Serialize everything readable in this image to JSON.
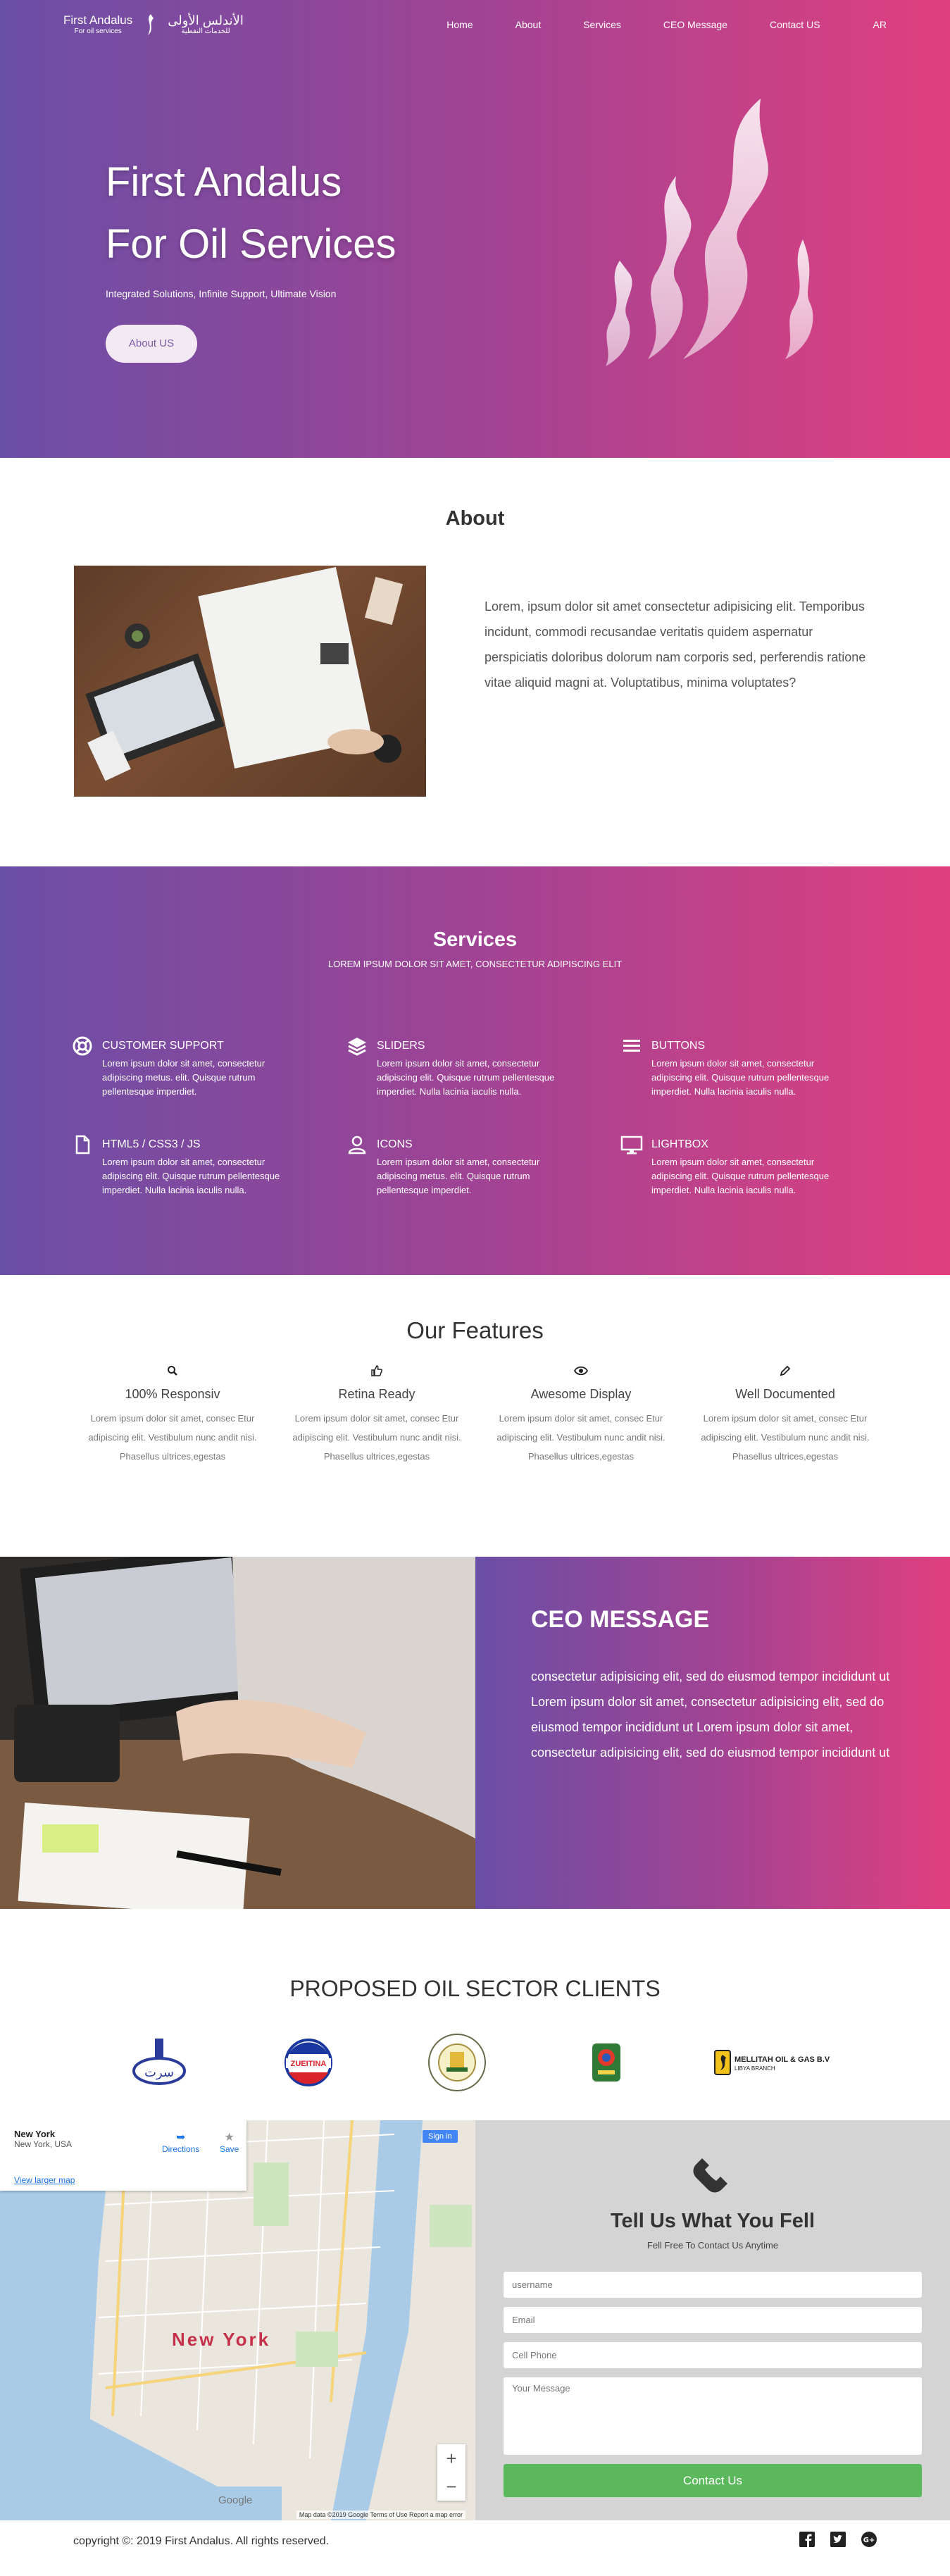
{
  "brand": {
    "name_en": "First Andalus",
    "tagline_en": "For oil services",
    "name_ar": "الأندلس الأولى",
    "tagline_ar": "للخدمات النفطية"
  },
  "nav": {
    "items": [
      "Home",
      "About",
      "Services",
      "CEO Message",
      "Contact US"
    ],
    "lang": "AR"
  },
  "hero": {
    "title_line1": "First Andalus",
    "title_line2": "For Oil Services",
    "subtitle": "Integrated Solutions, Infinite Support, Ultimate Vision",
    "button": "About US"
  },
  "about": {
    "title": "About",
    "text": "Lorem, ipsum dolor sit amet consectetur adipisicing elit. Temporibus incidunt, commodi recusandae veritatis quidem aspernatur perspiciatis doloribus dolorum nam corporis sed, perferendis ratione vitae aliquid magni at. Voluptatibus, minima voluptates?"
  },
  "services": {
    "title": "Services",
    "subtitle": "LOREM IPSUM DOLOR SIT AMET, CONSECTETUR ADIPISCING ELIT",
    "items": [
      {
        "icon": "life-ring-icon",
        "title": "CUSTOMER SUPPORT",
        "text": "Lorem ipsum dolor sit amet, consectetur adipiscing metus. elit. Quisque rutrum pellentesque imperdiet."
      },
      {
        "icon": "layers-icon",
        "title": "SLIDERS",
        "text": "Lorem ipsum dolor sit amet, consectetur adipiscing elit. Quisque rutrum pellentesque imperdiet. Nulla lacinia iaculis nulla."
      },
      {
        "icon": "menu-icon",
        "title": "BUTTONS",
        "text": "Lorem ipsum dolor sit amet, consectetur adipiscing elit. Quisque rutrum pellentesque imperdiet. Nulla lacinia iaculis nulla."
      },
      {
        "icon": "file-icon",
        "title": "HTML5 / CSS3 / JS",
        "text": "Lorem ipsum dolor sit amet, consectetur adipiscing elit. Quisque rutrum pellentesque imperdiet. Nulla lacinia iaculis nulla."
      },
      {
        "icon": "user-icon",
        "title": "ICONS",
        "text": "Lorem ipsum dolor sit amet, consectetur adipiscing metus. elit. Quisque rutrum pellentesque imperdiet."
      },
      {
        "icon": "monitor-icon",
        "title": "LIGHTBOX",
        "text": "Lorem ipsum dolor sit amet, consectetur adipiscing elit. Quisque rutrum pellentesque imperdiet. Nulla lacinia iaculis nulla."
      }
    ]
  },
  "features": {
    "title": "Our Features",
    "items": [
      {
        "icon": "search-icon",
        "title": "100% Responsiv",
        "text": "Lorem ipsum dolor sit amet, consec Etur adipiscing elit. Vestibulum nunc andit nisi. Phasellus ultrices,egestas"
      },
      {
        "icon": "thumbs-up-icon",
        "title": "Retina Ready",
        "text": "Lorem ipsum dolor sit amet, consec Etur adipiscing elit. Vestibulum nunc andit nisi. Phasellus ultrices,egestas"
      },
      {
        "icon": "eye-icon",
        "title": "Awesome Display",
        "text": "Lorem ipsum dolor sit amet, consec Etur adipiscing elit. Vestibulum nunc andit nisi. Phasellus ultrices,egestas"
      },
      {
        "icon": "pencil-icon",
        "title": "Well Documented",
        "text": "Lorem ipsum dolor sit amet, consec Etur adipiscing elit. Vestibulum nunc andit nisi. Phasellus ultrices,egestas"
      }
    ]
  },
  "ceo": {
    "title": "CEO MESSAGE",
    "text": "consectetur adipisicing elit, sed do eiusmod tempor incididunt ut Lorem ipsum dolor sit amet, consectetur adipisicing elit, sed do eiusmod tempor incididunt ut Lorem ipsum dolor sit amet, consectetur adipisicing elit, sed do eiusmod tempor incididunt ut"
  },
  "clients": {
    "title": "PROPOSED OIL SECTOR CLIENTS",
    "logo1_text": "سرت",
    "logo2_text": "ZUEITINA",
    "logo3_text": "",
    "logo4_text": "",
    "logo5_text": "MELLITAH OIL & GAS B.V",
    "logo5_sub": "LIBYA BRANCH"
  },
  "map": {
    "place": "New York",
    "address": "New York, USA",
    "directions": "Directions",
    "save": "Save",
    "larger": "View larger map",
    "signin": "Sign in",
    "label": "New York",
    "attribution": "Map data ©2019 Google   Terms of Use   Report a map error",
    "google": "Google",
    "zoom_in": "+",
    "zoom_out": "−"
  },
  "contact": {
    "title": "Tell Us What You Fell",
    "subtitle": "Fell Free To Contact Us Anytime",
    "ph_username": "username",
    "ph_email": "Email",
    "ph_phone": "Cell Phone",
    "ph_message": "Your Message",
    "button": "Contact Us"
  },
  "footer": {
    "copyright": "copyright ©: 2019 First Andalus. All rights reserved."
  },
  "colors": {
    "gradient_start": "#6a4fa6",
    "gradient_end": "#e0407f",
    "button_green": "#5cb85c"
  }
}
